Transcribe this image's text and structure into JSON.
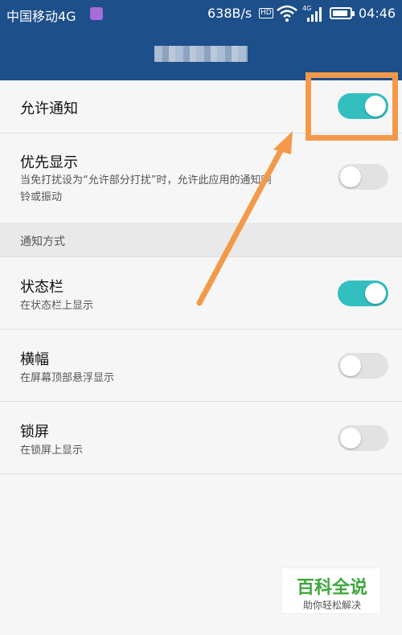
{
  "status_bar": {
    "carrier": "中国移动4G",
    "net_speed": "638B/s",
    "hd": "HD",
    "network": "4G",
    "time": "04:46"
  },
  "settings": {
    "allow_notifications": {
      "title": "允许通知",
      "enabled": true
    },
    "priority_display": {
      "title": "优先显示",
      "subtitle_line1": "当免打扰设为“允许部分打扰”时，允许此应用的通知响",
      "subtitle_line2": "铃或振动",
      "enabled": false
    },
    "section_label": "通知方式",
    "status_bar_item": {
      "title": "状态栏",
      "subtitle": "在状态栏上显示",
      "enabled": true
    },
    "banner": {
      "title": "横幅",
      "subtitle": "在屏幕顶部悬浮显示",
      "enabled": false
    },
    "lock_screen": {
      "title": "锁屏",
      "subtitle": "在锁屏上显示",
      "enabled": false
    }
  },
  "watermark": {
    "title": "百科全说",
    "subtitle": "助你轻松解决"
  },
  "colors": {
    "appbar": "#1d4f8a",
    "switch_on": "#33bfbf",
    "annotation": "#f39a4a"
  }
}
